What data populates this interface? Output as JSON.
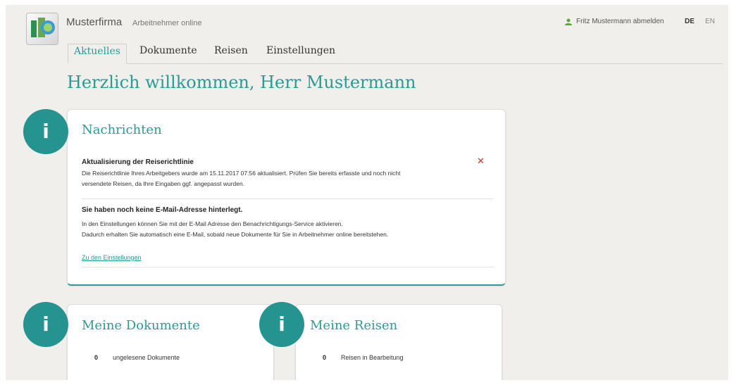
{
  "header": {
    "brand": "Musterfirma",
    "subtitle": "Arbeitnehmer online",
    "user_link": "Fritz Mustermann abmelden",
    "languages": [
      "DE",
      "EN"
    ]
  },
  "nav": {
    "tabs": [
      {
        "label": "Aktuelles"
      },
      {
        "label": "Dokumente"
      },
      {
        "label": "Reisen"
      },
      {
        "label": "Einstellungen"
      }
    ]
  },
  "page": {
    "title": "Herzlich willkommen, Herr Mustermann"
  },
  "news": {
    "icon_glyph": "i",
    "title": "Nachrichten",
    "msg1": {
      "title": "Aktualisierung der Reiserichtlinie",
      "line1": "Die Reiserichtlinie Ihres Arbeitgebers wurde am 15.11.2017 07:56 aktualisiert. Prüfen Sie bereits erfasste und noch nicht",
      "line2": "versendete Reisen, da Ihre Eingaben ggf. angepasst wurden.",
      "close": "✕"
    },
    "msg2": {
      "title": "Sie haben noch keine E-Mail-Adresse hinterlegt.",
      "line1": "In den Einstellungen können Sie mit der E-Mail Adresse den Benachrichtigungs-Service aktivieren.",
      "line2": "Dadurch erhalten Sie automatisch eine E-Mail, sobald neue Dokumente für Sie in Arbeitnehmer online bereitstehen.",
      "link": "Zu den Einstellungen"
    }
  },
  "documents": {
    "icon_glyph": "i",
    "title": "Meine Dokumente",
    "count": "0",
    "label": "ungelesene Dokumente"
  },
  "travels": {
    "icon_glyph": "i",
    "title": "Meine Reisen",
    "count": "0",
    "label": "Reisen in Bearbeitung"
  },
  "colors": {
    "accent": "#2a9a95",
    "circle": "#25938f",
    "close": "#d0312d",
    "user_icon": "#5aa83a"
  },
  "icons": {
    "logo": "company-logo-icon",
    "user": "user-icon",
    "info": "info-icon",
    "close": "close-icon"
  }
}
